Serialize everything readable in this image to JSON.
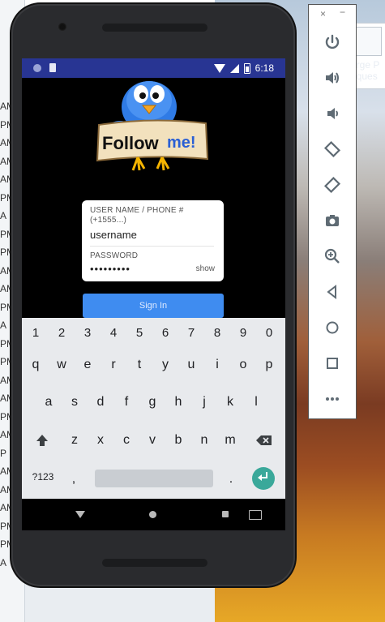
{
  "desktop": {
    "left_list_items": [
      "AM",
      "PM",
      "AM",
      "AM",
      "AM",
      "PM",
      "A",
      "PM",
      "PM",
      "AM",
      "AM",
      "PM",
      "A",
      "PM",
      "PM",
      "AM",
      "AM",
      "PM",
      "AM",
      "P",
      "AM",
      "AM",
      "AM",
      "PM",
      "PM",
      "A"
    ],
    "right_window_title_line1": "erge P",
    "right_window_title_line2": "eques"
  },
  "status_bar": {
    "time": "6:18"
  },
  "app": {
    "logo_text_follow": "Follow",
    "logo_text_me": "me!",
    "username_label_line1": "USER NAME / PHONE #",
    "username_label_line2": "(+1555...)",
    "username_value": "username",
    "password_label": "PASSWORD",
    "password_value": "•••••••••",
    "show_label": "show",
    "signin_label": "Sign In"
  },
  "keyboard": {
    "number_row": [
      "1",
      "2",
      "3",
      "4",
      "5",
      "6",
      "7",
      "8",
      "9",
      "0"
    ],
    "row1": [
      "q",
      "w",
      "e",
      "r",
      "t",
      "y",
      "u",
      "i",
      "o",
      "p"
    ],
    "row2": [
      "a",
      "s",
      "d",
      "f",
      "g",
      "h",
      "j",
      "k",
      "l"
    ],
    "row3": [
      "z",
      "x",
      "c",
      "v",
      "b",
      "n",
      "m"
    ],
    "symbols_label": "?123",
    "comma": ",",
    "period": "."
  },
  "emulator_toolbar": {
    "close_glyph": "×",
    "minimize_glyph": "−"
  },
  "colors": {
    "status_bar": "#283593",
    "signin_button": "#3f8cf0",
    "enter_key": "#3aa89a"
  }
}
